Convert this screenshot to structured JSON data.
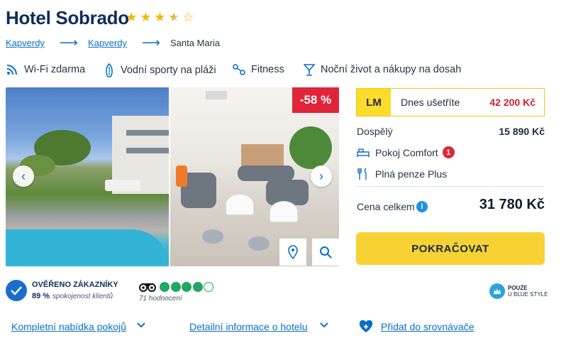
{
  "hotel": {
    "name": "Hotel Sobrado",
    "rating_stars": 3.5
  },
  "breadcrumb": [
    "Kapverdy",
    "Kapverdy",
    "Santa Maria"
  ],
  "features": [
    {
      "label": "Wi-Fi zdarma",
      "icon": "wifi-icon"
    },
    {
      "label": "Vodní sporty na pláži",
      "icon": "surfboard-icon"
    },
    {
      "label": "Fitness",
      "icon": "fitness-icon"
    },
    {
      "label": "Noční život a nákupy na dosah",
      "icon": "cocktail-icon"
    }
  ],
  "gallery": {
    "discount": "-58 %"
  },
  "offer": {
    "lm_badge": "LM",
    "save_label": "Dnes ušetříte",
    "save_value": "42 200 Kč",
    "adult_label": "Dospělý",
    "adult_price": "15 890 Kč",
    "room": "Pokoj Comfort",
    "room_badge": "1",
    "board": "Plná penze Plus",
    "total_label": "Cena celkem",
    "total_value": "31 780 Kč",
    "cta": "POKRAČOVAT"
  },
  "verification": {
    "title": "OVĚŘENO ZÁKAZNÍKY",
    "percent": "89 %",
    "subtitle": "spokojenost klientů"
  },
  "tripadvisor": {
    "rating": 4,
    "max": 5,
    "count": "71 hodnocení"
  },
  "blue_style": {
    "line1": "POUZE",
    "line2": "U BLUE STYLE"
  },
  "links": {
    "rooms": "Kompletní nabídka pokojů",
    "details": "Detailní informace o hotelu",
    "compare": "Přidat do srovnávače"
  },
  "colors": {
    "brand_blue": "#0b6fc7",
    "title_navy": "#0f2e5a",
    "discount_red": "#e0253a",
    "cta_yellow": "#f6d234",
    "ta_green": "#21a663"
  }
}
